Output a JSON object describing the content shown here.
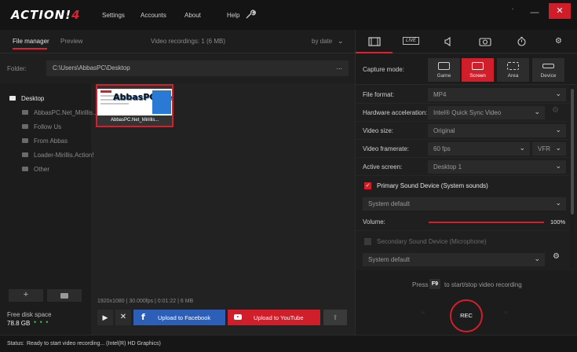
{
  "app": {
    "logo_text": "ACTION!",
    "logo_num": "4"
  },
  "menu": [
    "Settings",
    "Accounts",
    "About",
    "Help"
  ],
  "window": {
    "close": "✕",
    "minimize": "—",
    "dot": "·"
  },
  "left": {
    "tab_file_manager": "File manager",
    "tab_preview": "Preview",
    "video_recordings": "Video recordings: 1 (6 MB)",
    "sort": "by date",
    "folder_label": "Folder:",
    "folder_path": "C:\\Users\\AbbasPC\\Desktop",
    "folder_more": "...",
    "tree": [
      "Desktop",
      "AbbasPC.Net_Mirillis...",
      "Follow Us",
      "From Abbas",
      "Loader-Mirillis.Action!",
      "Other"
    ],
    "add_label": "+",
    "disk_label": "Free disk space",
    "disk_value": "78.8 GB",
    "disk_dots": "• • •",
    "thumb_logo": "AbbasPC.Net",
    "thumb_caption": "AbbasPC.Net_Mirillis...",
    "video_info": "1920x1080 | 30.000fps | 0:01:22 | 6 MB",
    "play": "▶",
    "delete": "✕",
    "fb_icon": "f",
    "fb_label": "Upload to Facebook",
    "yt_label": "Upload to YouTube",
    "upload": "⬆"
  },
  "right": {
    "tabs": [
      {
        "name": "video",
        "glyph": "▭"
      },
      {
        "name": "live",
        "glyph": "LIVE"
      },
      {
        "name": "audio",
        "glyph": "◁)"
      },
      {
        "name": "screenshot",
        "glyph": "◎"
      },
      {
        "name": "benchmark",
        "glyph": "◷"
      },
      {
        "name": "settings",
        "glyph": "⚙"
      }
    ],
    "capture_label": "Capture mode:",
    "modes": [
      "Game",
      "Screen",
      "Area",
      "Device"
    ],
    "file_format_label": "File format:",
    "file_format": "MP4",
    "hw_label": "Hardware acceleration:",
    "hw_value": "Intel® Quick Sync Video",
    "size_label": "Video size:",
    "size_value": "Original",
    "fps_label": "Video framerate:",
    "fps_value": "60 fps",
    "vfr": "VFR",
    "screen_label": "Active screen:",
    "screen_value": "Desktop 1",
    "primary_label": "Primary Sound Device (System sounds)",
    "primary_device": "System default",
    "volume_label": "Volume:",
    "volume_value": "100%",
    "volume_level": 1.0,
    "secondary_label": "Secondary Sound Device (Microphone)",
    "secondary_device": "System default",
    "check_mark": "✓",
    "chevron": "⌄",
    "gear": "⚙",
    "press": "Press",
    "hotkey": "F9",
    "start_stop": "to start/stop video recording",
    "rec": "REC",
    "rec_left": "«",
    "rec_right": "»"
  },
  "status": {
    "label": "Status:",
    "text": "Ready to start video recording... (Intel(R) HD Graphics)"
  },
  "colors": {
    "accent": "#d01f2b",
    "facebook": "#2d5fb8",
    "disk_ok": "#3cb94a"
  }
}
